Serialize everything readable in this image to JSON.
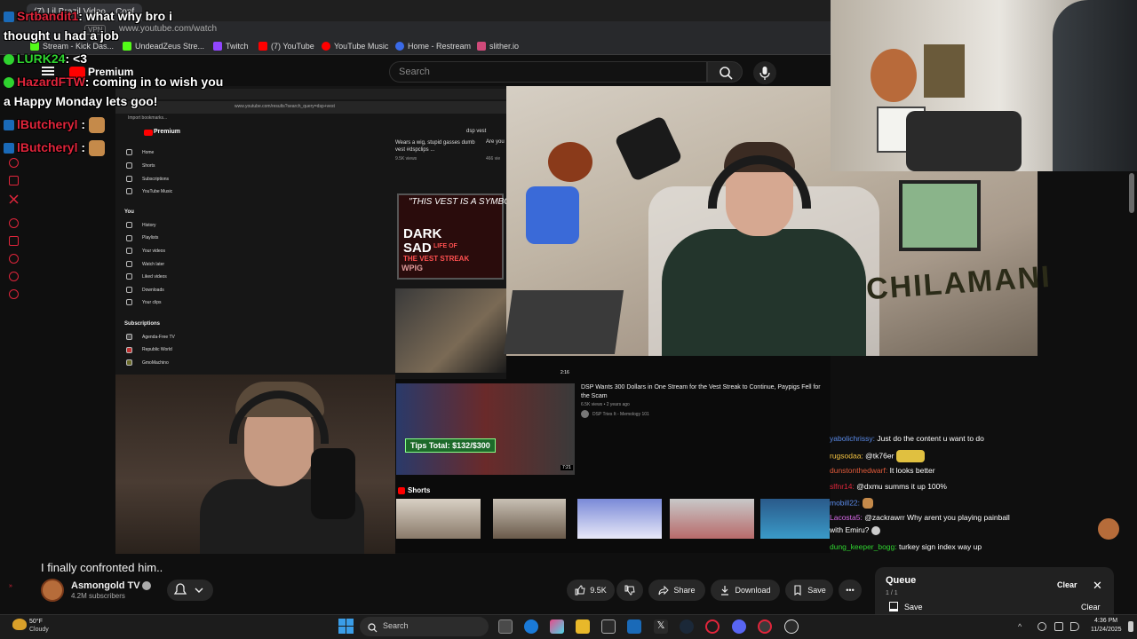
{
  "browser": {
    "tab_title": "(7) Lil Brazil Video... Conf",
    "vpn_label": "VPN",
    "url": "www.youtube.com/watch",
    "bookmarks": [
      {
        "label": "Stream - Kick Das...",
        "color": "#53fc18"
      },
      {
        "label": "UndeadZeus Stre...",
        "color": "#53fc18"
      },
      {
        "label": "Twitch",
        "color": "#9146ff"
      },
      {
        "label": "(7) YouTube",
        "color": "#ff0000"
      },
      {
        "label": "YouTube Music",
        "color": "#ff0000"
      },
      {
        "label": "Home - Restream",
        "color": "#3a6ae8"
      },
      {
        "label": "slither.io",
        "color": "#d04a7a"
      }
    ]
  },
  "youtube": {
    "premium_label": "Premium",
    "search_placeholder": "Search"
  },
  "overlay_chat": [
    {
      "user": "Srtbandit1",
      "text": ": what why bro i",
      "user_color": "#e0253b"
    },
    {
      "user": "",
      "text": "thought u had a job",
      "user_color": "#ffffff"
    },
    {
      "user": "LURK24",
      "text": ": <3",
      "user_color": "#2fd32f"
    },
    {
      "user": "HazardFTW",
      "text": ": coming in to wish you",
      "user_color": "#e0253b"
    },
    {
      "user": "",
      "text": "a Happy Monday lets goo!",
      "user_color": "#ffffff"
    },
    {
      "user": "lButcheryl",
      "text": " :",
      "user_color": "#e0253b"
    },
    {
      "user": "lButcheryl",
      "text": " :",
      "user_color": "#e0253b"
    }
  ],
  "inner_page": {
    "url": "www.youtube.com/results?search_query=dsp+vest",
    "bookmarks_text": "Import bookmarks...",
    "premium": "Premium",
    "search_text": "dsp vest",
    "nav": [
      "Home",
      "Shorts",
      "Subscriptions",
      "YouTube Music"
    ],
    "you_header": "You",
    "you_items": [
      "History",
      "Playlists",
      "Your videos",
      "Watch later",
      "Liked videos",
      "Downloads",
      "Your clips"
    ],
    "subs_header": "Subscriptions",
    "subs_items": [
      "Agenda-Free TV",
      "Republic World",
      "GmoMachino"
    ],
    "vid1_title": "Wears a wig, stupid gasses dumb vest #dspclips ...",
    "vid1_views": "9.5K views",
    "vid2_title": "Are you",
    "vid2_views": "466 vie",
    "thumb_quote": "\"THIS VEST IS A SYMBOL...\"",
    "thumb_dark": "DARK",
    "thumb_sad": "SAD",
    "thumb_life": "LIFE OF",
    "thumb_streak": "THE VEST STREAK",
    "thumb_wpig": "WPIG",
    "time_216": "2:16",
    "tips_badge": "Tips Total: $132/$300",
    "dsp_vid_title": "DSP Wants 300 Dollars in One Stream for the Vest Streak to Continue, Paypigs Fell for the Scam",
    "dsp_vid_meta": "6.5K views • 2 years ago",
    "dsp_vid_channel": "DSP Tries It - Memology 101",
    "dsp_vid_duration": "7:21",
    "shorts_label": "Shorts",
    "dsp_banner": "CHILAMANI"
  },
  "video_chat": [
    {
      "user": "yabolichrissy:",
      "text": " Just do the content u want to do",
      "color": "#5a8ae8"
    },
    {
      "user": "rugsodaa:",
      "text": " @tk76er",
      "color": "#f0c040"
    },
    {
      "user": "dunstonthedwarf:",
      "text": " It looks better",
      "color": "#e05a3a"
    },
    {
      "user": "slfnr14:",
      "text": " @dxmu summs it up 100%",
      "color": "#e0253b"
    },
    {
      "user": "mobill22:",
      "text": "",
      "color": "#5a8ae8"
    },
    {
      "user": "Lacosta5:",
      "text": " @zackrawrr Why arent you playing painball",
      "color": "#d86ae8"
    },
    {
      "user": "",
      "text": "with Emiru?",
      "color": "#ffffff"
    },
    {
      "user": "dung_keeper_bogg:",
      "text": " turkey sign index way up",
      "color": "#2fd32f"
    }
  ],
  "video": {
    "title": "I finally confronted him..",
    "channel": "Asmongold TV",
    "subscribers": "4.2M subscribers",
    "likes": "9.5K",
    "share_label": "Share",
    "download_label": "Download",
    "save_label": "Save"
  },
  "queue": {
    "title": "Queue",
    "count": "1 / 1",
    "clear_label": "Clear",
    "save_label": "Save",
    "clear2_label": "Clear"
  },
  "taskbar": {
    "weather_temp": "50°F",
    "weather_desc": "Cloudy",
    "search_label": "Search",
    "time": "4:36 PM",
    "date": "11/24/2025"
  },
  "colors": {
    "accent_red": "#e0253b",
    "youtube_red": "#ff0000",
    "background": "#0f0f0f"
  }
}
